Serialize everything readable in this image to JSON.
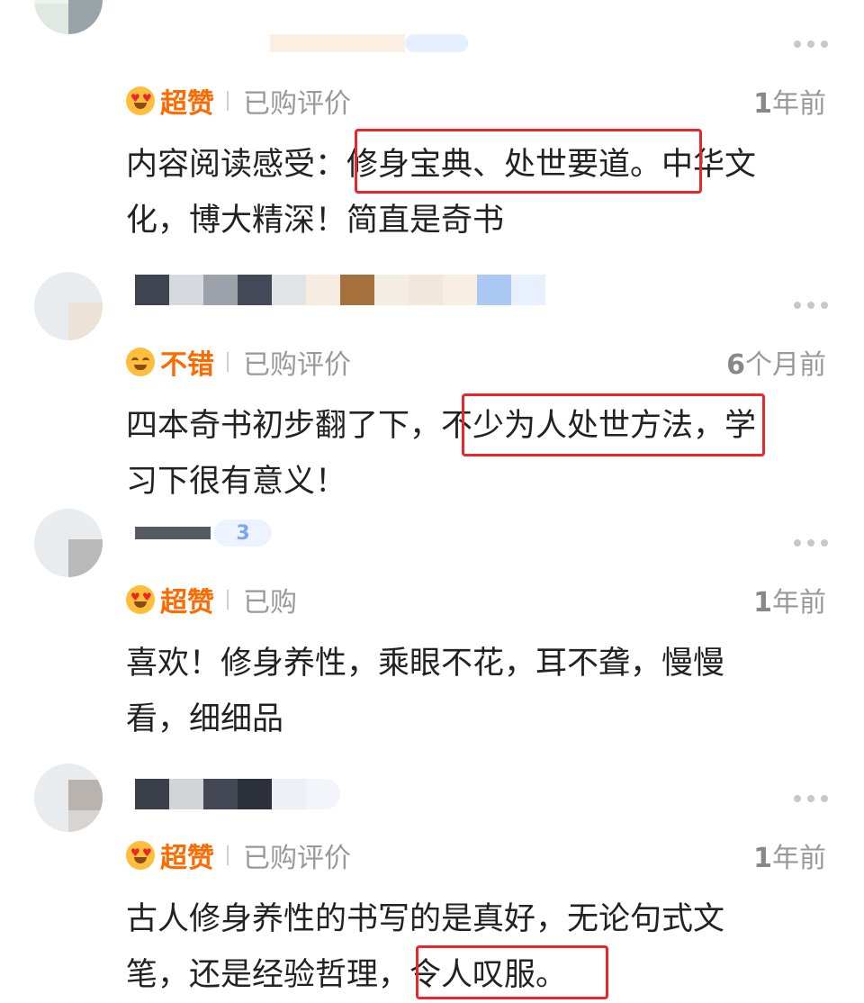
{
  "reviews": [
    {
      "rating": "超赞",
      "purchase": "已购评价",
      "time_num": "1",
      "time_unit": "年前",
      "lines": [
        "内容阅读感受：修身宝典、处世要道。中华文",
        "化，博大精深！简直是奇书"
      ]
    },
    {
      "rating": "不错",
      "purchase": "已购评价",
      "time_num": "6",
      "time_unit": "个月前",
      "lines": [
        "四本奇书初步翻了下，不少为人处世方法，学",
        "习下很有意义！"
      ]
    },
    {
      "rating": "超赞",
      "purchase": "已购",
      "time_num": "1",
      "time_unit": "年前",
      "badge": "3",
      "lines": [
        "喜欢！修身养性，乘眼不花，耳不聋，慢慢",
        "看，细细品"
      ]
    },
    {
      "rating": "超赞",
      "purchase": "已购评价",
      "time_num": "1",
      "time_unit": "年前",
      "lines": [
        "古人修身养性的书写的是真好，无论句式文",
        "笔，还是经验哲理，令人叹服。"
      ]
    }
  ],
  "colors": {
    "rating": "#ff6a00",
    "highlight": "#e8262b",
    "muted": "#999999"
  },
  "icons": {
    "more": "more-dots-icon",
    "love_eyes": "heart-eyes-emoji-icon",
    "smile": "smile-emoji-icon"
  }
}
